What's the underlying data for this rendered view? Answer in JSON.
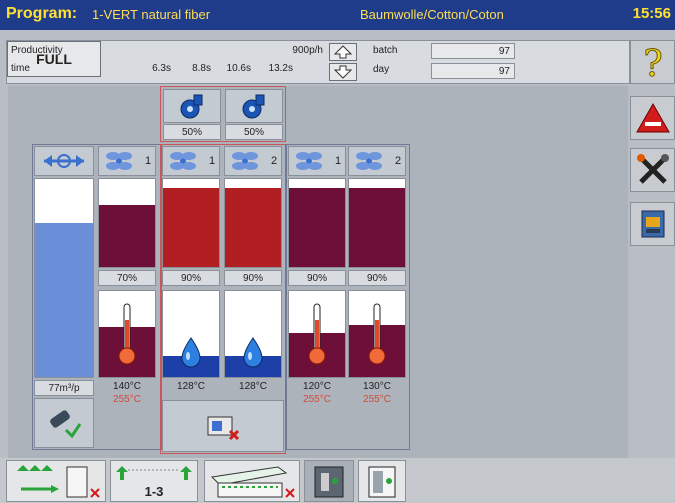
{
  "header": {
    "program_label": "Program:",
    "program_name": "1-VERT natural fiber",
    "material": "Baumwolle/Cotton/Coton",
    "time": "15:56"
  },
  "info": {
    "productivity_label": "Productivity",
    "productivity_value": "900p/h",
    "time_label": "time",
    "time_values": [
      "6.3s",
      "8.8s",
      "10.6s",
      "13.2s"
    ],
    "batch_label": "batch",
    "batch_value": "97",
    "day_label": "day",
    "day_value": "97",
    "full_label": "FULL"
  },
  "zones": {
    "blowers": [
      {
        "pct": "50%"
      },
      {
        "pct": "50%"
      }
    ],
    "dryer_level": {
      "flow": "77m³/p",
      "fill_pct": 0.78
    },
    "fan_cols": [
      {
        "index": "1",
        "pct": "70%",
        "fill": 0.72,
        "color": "#6e0f3a",
        "temp": "140°C",
        "set": "255°C",
        "temp_fill": 0.6
      },
      {
        "index": "1",
        "pct": "90%",
        "fill": 0.92,
        "color": "#b21f22",
        "temp": "128°C",
        "set": "",
        "temp_fill": 0.25
      },
      {
        "index": "2",
        "pct": "90%",
        "fill": 0.92,
        "color": "#b21f22",
        "temp": "128°C",
        "set": "",
        "temp_fill": 0.25
      },
      {
        "index": "1",
        "pct": "90%",
        "fill": 0.92,
        "color": "#6e0f3a",
        "temp": "120°C",
        "set": "255°C",
        "temp_fill": 0.52
      },
      {
        "index": "2",
        "pct": "90%",
        "fill": 0.92,
        "color": "#6e0f3a",
        "temp": "130°C",
        "set": "255°C",
        "temp_fill": 0.62
      }
    ]
  },
  "bottom": {
    "stacker_label": "1-3"
  },
  "colors": {
    "header_bg": "#1f3c8a",
    "header_text": "#ffe033",
    "fill_dark": "#6e0f3a",
    "fill_red": "#b21f22",
    "water_blue": "#1c3fa8",
    "level_blue": "#6a8fd8"
  }
}
